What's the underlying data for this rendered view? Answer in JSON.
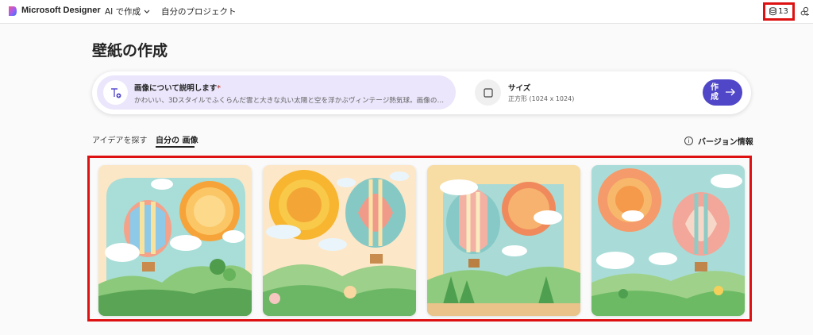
{
  "app": {
    "brand": "Microsoft Designer"
  },
  "nav": {
    "ai_create": "AI で作成",
    "my_projects": "自分のプロジェクト"
  },
  "credits": {
    "count": "13"
  },
  "page": {
    "title": "壁紙の作成"
  },
  "prompt": {
    "label": "画像について説明します",
    "required_mark": "*",
    "text": "かわいい、3Dスタイルでふくらんだ雲と大きな丸い太陽と空を浮かぶヴィンテージ熱気球。画像の下部には…"
  },
  "size": {
    "label": "サイズ",
    "value": "正方形 (1024 x 1024)"
  },
  "create_button": {
    "label": "作成"
  },
  "tabs": [
    {
      "label": "アイデアを探す"
    },
    {
      "label": "自分の 画像"
    }
  ],
  "version_info": "バージョン情報",
  "colors": {
    "accent": "#4f46c8",
    "highlight": "#dd1111",
    "prompt_bg": "#ebe6fb"
  },
  "images": [
    {
      "name": "generated-image-1"
    },
    {
      "name": "generated-image-2"
    },
    {
      "name": "generated-image-3"
    },
    {
      "name": "generated-image-4"
    }
  ]
}
